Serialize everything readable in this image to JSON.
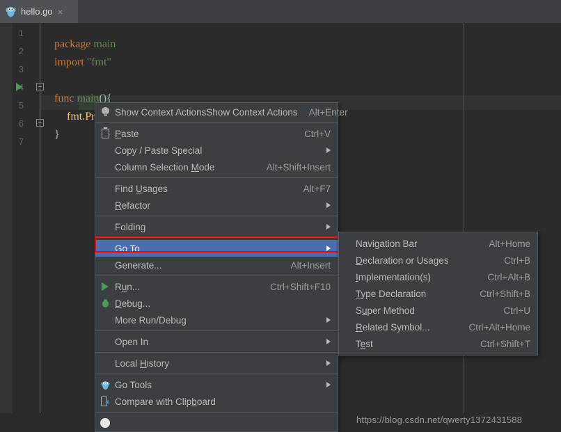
{
  "tab": {
    "label": "hello.go",
    "close": "×",
    "icon": "go-gopher-icon"
  },
  "editor": {
    "line_numbers": [
      "1",
      "2",
      "3",
      "4",
      "5",
      "6",
      "7"
    ],
    "code": {
      "l1_kw": "package",
      "l1_ident": "main",
      "l2_kw": "import",
      "l2_str": "\"fmt\"",
      "l4_kw": "func",
      "l4_name": "main",
      "l4_tail": "(){",
      "l5": "fmt.Println(\"....\"...)",
      "l6": "}"
    },
    "colors": {
      "background": "#2b2b2b",
      "gutter": "#313335",
      "keyword": "#cc7832",
      "string": "#6a8759",
      "identifier": "#6a8759",
      "text": "#a9b7c6",
      "current_line": "#323232",
      "selection": "#344134",
      "run_marker": "#499c54"
    }
  },
  "watermark": {
    "text": "https://blog.csdn.net/qwerty1372431588"
  },
  "context_menu": {
    "highlight_color": "#4b6eaf",
    "annotation_color": "#fb0007",
    "items": [
      {
        "label": "Show Context Actions",
        "label_pre": "",
        "mnemonic": "",
        "label_post": "Show Context Actions",
        "shortcut": "Alt+Enter",
        "icon": "lightbulb-icon",
        "submenu": false,
        "selected": false
      },
      {
        "sep": true
      },
      {
        "label": "Paste",
        "label_pre": "",
        "mnemonic": "P",
        "label_post": "aste",
        "shortcut": "Ctrl+V",
        "icon": "clipboard-icon",
        "submenu": false,
        "selected": false
      },
      {
        "label": "Copy / Paste Special",
        "label_pre": "Copy / Paste Special",
        "mnemonic": "",
        "label_post": "",
        "shortcut": "",
        "icon": "",
        "submenu": true,
        "selected": false
      },
      {
        "label": "Column Selection Mode",
        "label_pre": "Column Selection ",
        "mnemonic": "M",
        "label_post": "ode",
        "shortcut": "Alt+Shift+Insert",
        "icon": "",
        "submenu": false,
        "selected": false
      },
      {
        "sep": true
      },
      {
        "label": "Find Usages",
        "label_pre": "Find ",
        "mnemonic": "U",
        "label_post": "sages",
        "shortcut": "Alt+F7",
        "icon": "",
        "submenu": false,
        "selected": false
      },
      {
        "label": "Refactor",
        "label_pre": "",
        "mnemonic": "R",
        "label_post": "efactor",
        "shortcut": "",
        "icon": "",
        "submenu": true,
        "selected": false
      },
      {
        "sep": true
      },
      {
        "label": "Folding",
        "label_pre": "Folding",
        "mnemonic": "",
        "label_post": "",
        "shortcut": "",
        "icon": "",
        "submenu": true,
        "selected": false
      },
      {
        "sep": true
      },
      {
        "label": "Go To",
        "label_pre": "Go To",
        "mnemonic": "",
        "label_post": "",
        "shortcut": "",
        "icon": "",
        "submenu": true,
        "selected": true
      },
      {
        "label": "Generate...",
        "label_pre": "Generate...",
        "mnemonic": "",
        "label_post": "",
        "shortcut": "Alt+Insert",
        "icon": "",
        "submenu": false,
        "selected": false
      },
      {
        "sep": true
      },
      {
        "label": "Run...",
        "label_pre": "R",
        "mnemonic": "u",
        "label_post": "n...",
        "shortcut": "Ctrl+Shift+F10",
        "icon": "run-icon",
        "submenu": false,
        "selected": false
      },
      {
        "label": "Debug...",
        "label_pre": "",
        "mnemonic": "D",
        "label_post": "ebug...",
        "shortcut": "",
        "icon": "debug-icon",
        "submenu": false,
        "selected": false
      },
      {
        "label": "More Run/Debug",
        "label_pre": "More Run/Debug",
        "mnemonic": "",
        "label_post": "",
        "shortcut": "",
        "icon": "",
        "submenu": true,
        "selected": false
      },
      {
        "sep": true
      },
      {
        "label": "Open In",
        "label_pre": "Open In",
        "mnemonic": "",
        "label_post": "",
        "shortcut": "",
        "icon": "",
        "submenu": true,
        "selected": false
      },
      {
        "sep": true
      },
      {
        "label": "Local History",
        "label_pre": "Local ",
        "mnemonic": "H",
        "label_post": "istory",
        "shortcut": "",
        "icon": "",
        "submenu": true,
        "selected": false
      },
      {
        "sep": true
      },
      {
        "label": "Go Tools",
        "label_pre": "Go Tools",
        "mnemonic": "",
        "label_post": "",
        "shortcut": "",
        "icon": "go-gopher-icon",
        "submenu": true,
        "selected": false
      },
      {
        "label": "Compare with Clipboard",
        "label_pre": "Compare with Clip",
        "mnemonic": "b",
        "label_post": "oard",
        "shortcut": "",
        "icon": "compare-clipboard-icon",
        "submenu": false,
        "selected": false
      },
      {
        "sep": true
      }
    ]
  },
  "submenu": {
    "items": [
      {
        "label": "Navigation Bar",
        "label_pre": "Navigation Bar",
        "mnemonic": "",
        "label_post": "",
        "shortcut": "Alt+Home"
      },
      {
        "label": "Declaration or Usages",
        "label_pre": "",
        "mnemonic": "D",
        "label_post": "eclaration or Usages",
        "shortcut": "Ctrl+B"
      },
      {
        "label": "Implementation(s)",
        "label_pre": "",
        "mnemonic": "I",
        "label_post": "mplementation(s)",
        "shortcut": "Ctrl+Alt+B"
      },
      {
        "label": "Type Declaration",
        "label_pre": "",
        "mnemonic": "T",
        "label_post": "ype Declaration",
        "shortcut": "Ctrl+Shift+B"
      },
      {
        "label": "Super Method",
        "label_pre": "S",
        "mnemonic": "u",
        "label_post": "per Method",
        "shortcut": "Ctrl+U"
      },
      {
        "label": "Related Symbol...",
        "label_pre": "",
        "mnemonic": "R",
        "label_post": "elated Symbol...",
        "shortcut": "Ctrl+Alt+Home"
      },
      {
        "label": "Test",
        "label_pre": "T",
        "mnemonic": "e",
        "label_post": "st",
        "shortcut": "Ctrl+Shift+T"
      }
    ]
  }
}
